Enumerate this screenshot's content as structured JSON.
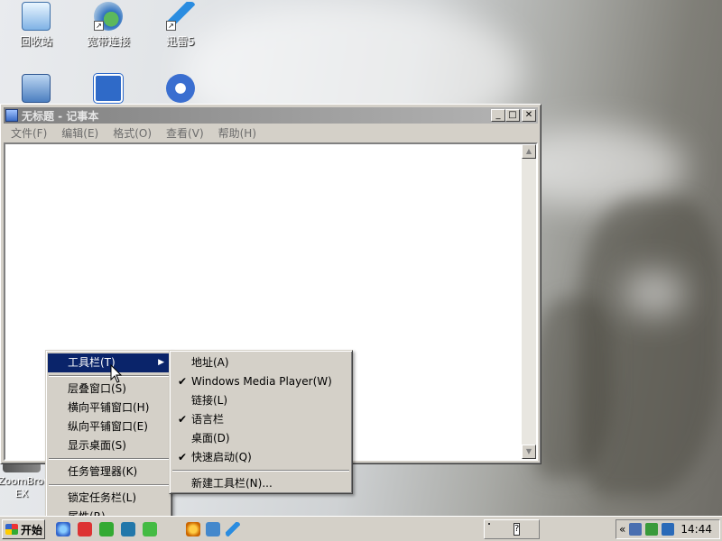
{
  "desktop": {
    "icons": [
      {
        "label": "回收站"
      },
      {
        "label": "宽带连接"
      },
      {
        "label": "迅雷5"
      },
      {
        "label": "ZoomBrowser EX"
      }
    ]
  },
  "notepad": {
    "title": "无标题 - 记事本",
    "menus": [
      "文件(F)",
      "编辑(E)",
      "格式(O)",
      "查看(V)",
      "帮助(H)"
    ],
    "content": ""
  },
  "context_menu": {
    "items": [
      {
        "label": "工具栏(T)",
        "has_submenu": true,
        "highlighted": true
      },
      {
        "label": "层叠窗口(S)"
      },
      {
        "label": "横向平铺窗口(H)"
      },
      {
        "label": "纵向平铺窗口(E)"
      },
      {
        "label": "显示桌面(S)"
      },
      {
        "label": "任务管理器(K)"
      },
      {
        "label": "锁定任务栏(L)"
      },
      {
        "label": "属性(R)"
      }
    ]
  },
  "toolbar_submenu": {
    "items": [
      {
        "label": "地址(A)",
        "checked": false
      },
      {
        "label": "Windows Media Player(W)",
        "checked": true
      },
      {
        "label": "链接(L)",
        "checked": false
      },
      {
        "label": "语言栏",
        "checked": true
      },
      {
        "label": "桌面(D)",
        "checked": false
      },
      {
        "label": "快速启动(Q)",
        "checked": true
      },
      {
        "label": "新建工具栏(N)...",
        "checked": false
      }
    ]
  },
  "taskbar": {
    "start_label": "开始",
    "clock": "14:44",
    "tray_expand": "«"
  },
  "icons": {
    "check": "✔",
    "submenu_arrow": "▶"
  },
  "colors": {
    "menu_highlight": "#0a246a",
    "inactive_title": "#808080"
  }
}
